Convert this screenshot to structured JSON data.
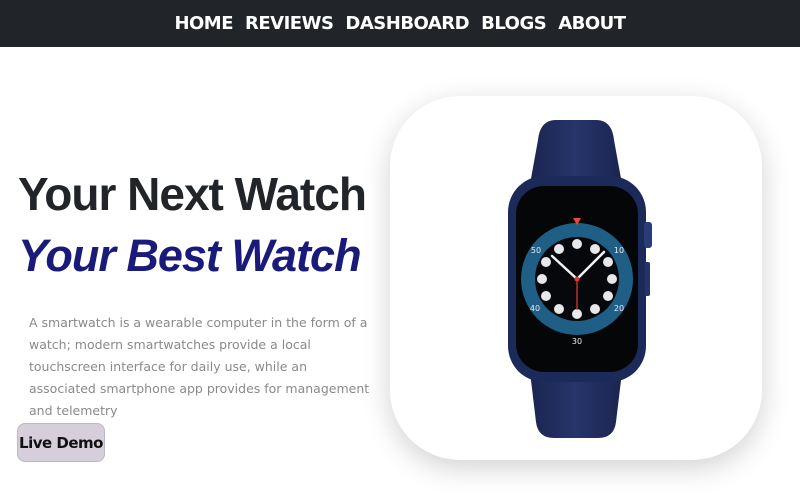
{
  "nav": {
    "items": [
      "HOME",
      "REVIEWS",
      "DASHBOARD",
      "BLOGS",
      "ABOUT"
    ]
  },
  "hero": {
    "title_line1": "Your Next Watch",
    "title_line2": "Your Best Watch",
    "description": "A smartwatch is a wearable computer in the form of a watch; modern smartwatches provide a local touchscreen interface for daily use, while an associated smartphone app provides for management and telemetry",
    "cta_label": "Live Demo"
  },
  "watch": {
    "dial_numbers": [
      "50",
      "10",
      "40",
      "20",
      "30"
    ]
  },
  "colors": {
    "nav_bg": "#212529",
    "title_dark": "#212529",
    "title_accent": "#1a1a7a",
    "button_bg": "#d6cfdb",
    "watch_case": "#1c2a5a",
    "dial_ring": "#1f5f86"
  }
}
